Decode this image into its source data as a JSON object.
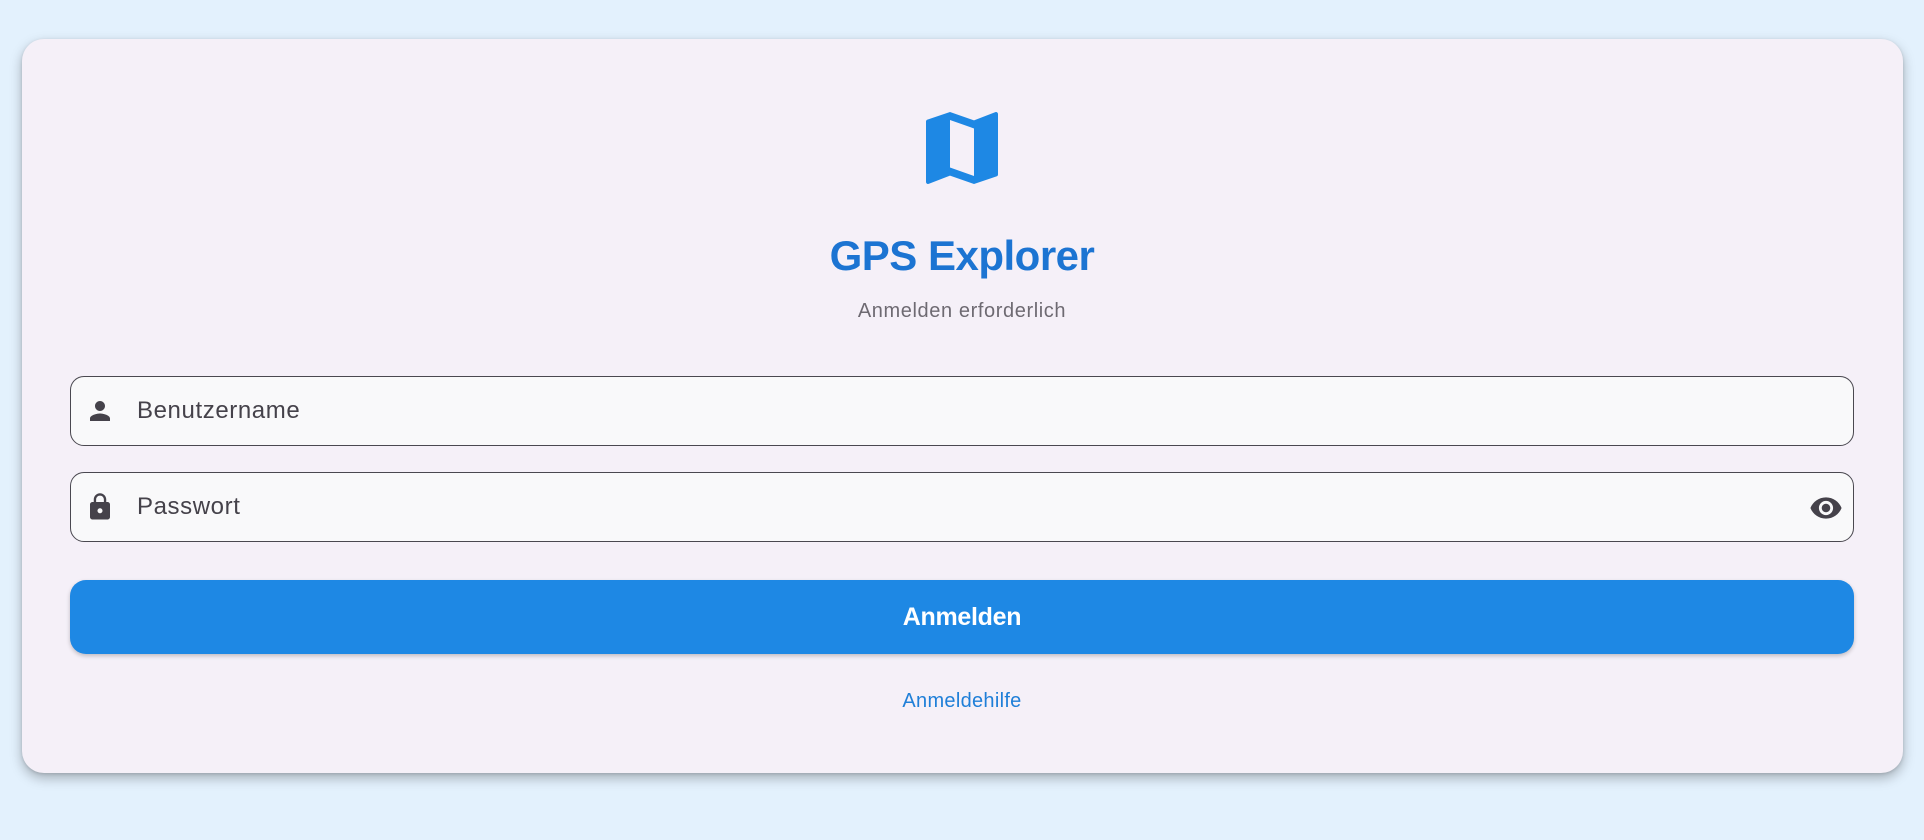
{
  "app": {
    "title": "GPS Explorer",
    "subtitle": "Anmelden erforderlich",
    "logo_icon": "map-icon"
  },
  "form": {
    "username": {
      "placeholder": "Benutzername",
      "value": "",
      "icon": "person-icon"
    },
    "password": {
      "placeholder": "Passwort",
      "value": "",
      "icon": "lock-icon",
      "toggle_icon": "eye-icon"
    },
    "submit_label": "Anmelden",
    "help_label": "Anmeldehilfe"
  },
  "colors": {
    "background": "#e3f1fd",
    "card": "#f5f0f8",
    "accent": "#1e88e4",
    "title": "#1c74d2",
    "link": "#1f7fd8",
    "subtitle": "#6e6a72"
  }
}
